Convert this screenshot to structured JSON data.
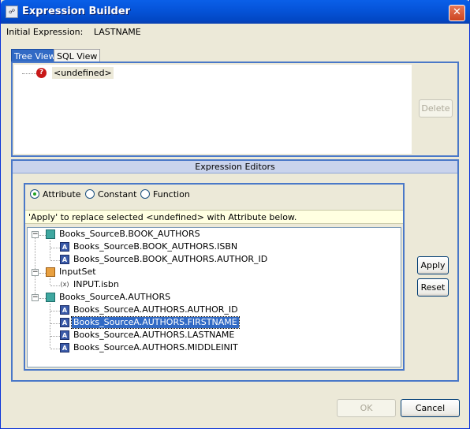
{
  "window": {
    "title": "Expression Builder",
    "icon_text": "☍",
    "close_glyph": "✕"
  },
  "initial_expression": {
    "label": "Initial Expression:",
    "value": "LASTNAME"
  },
  "tabs": [
    {
      "label": "Tree View",
      "selected": true
    },
    {
      "label": "SQL View",
      "selected": false
    }
  ],
  "expression_tree": {
    "node_label": "<undefined>",
    "node_icon": "question-icon",
    "delete_label": "Delete"
  },
  "editors": {
    "header": "Expression Editors",
    "radios": [
      {
        "label": "Attribute",
        "checked": true
      },
      {
        "label": "Constant",
        "checked": false
      },
      {
        "label": "Function",
        "checked": false
      }
    ],
    "hint": "'Apply' to replace selected <undefined> with Attribute below.",
    "tree": [
      {
        "label": "Books_SourceB.BOOK_AUTHORS",
        "icon": "table-icon",
        "level": 0,
        "expander": "−"
      },
      {
        "label": "Books_SourceB.BOOK_AUTHORS.ISBN",
        "icon": "attribute-icon",
        "level": 1
      },
      {
        "label": "Books_SourceB.BOOK_AUTHORS.AUTHOR_ID",
        "icon": "attribute-icon",
        "level": 1
      },
      {
        "label": "InputSet",
        "icon": "input-set-icon",
        "level": 0,
        "expander": "−"
      },
      {
        "label": "INPUT.isbn",
        "icon": "variable-icon",
        "level": 1
      },
      {
        "label": "Books_SourceA.AUTHORS",
        "icon": "table-icon",
        "level": 0,
        "expander": "−"
      },
      {
        "label": "Books_SourceA.AUTHORS.AUTHOR_ID",
        "icon": "attribute-icon",
        "level": 1
      },
      {
        "label": "Books_SourceA.AUTHORS.FIRSTNAME",
        "icon": "attribute-icon",
        "level": 1,
        "selected": true
      },
      {
        "label": "Books_SourceA.AUTHORS.LASTNAME",
        "icon": "attribute-icon",
        "level": 1
      },
      {
        "label": "Books_SourceA.AUTHORS.MIDDLEINIT",
        "icon": "attribute-icon",
        "level": 1
      }
    ],
    "apply_label": "Apply",
    "reset_label": "Reset"
  },
  "footer": {
    "ok_label": "OK",
    "cancel_label": "Cancel"
  },
  "colors": {
    "selection": "#316AC5",
    "panel_border": "#4A78C8",
    "hint_bg": "#FFFFE1"
  }
}
